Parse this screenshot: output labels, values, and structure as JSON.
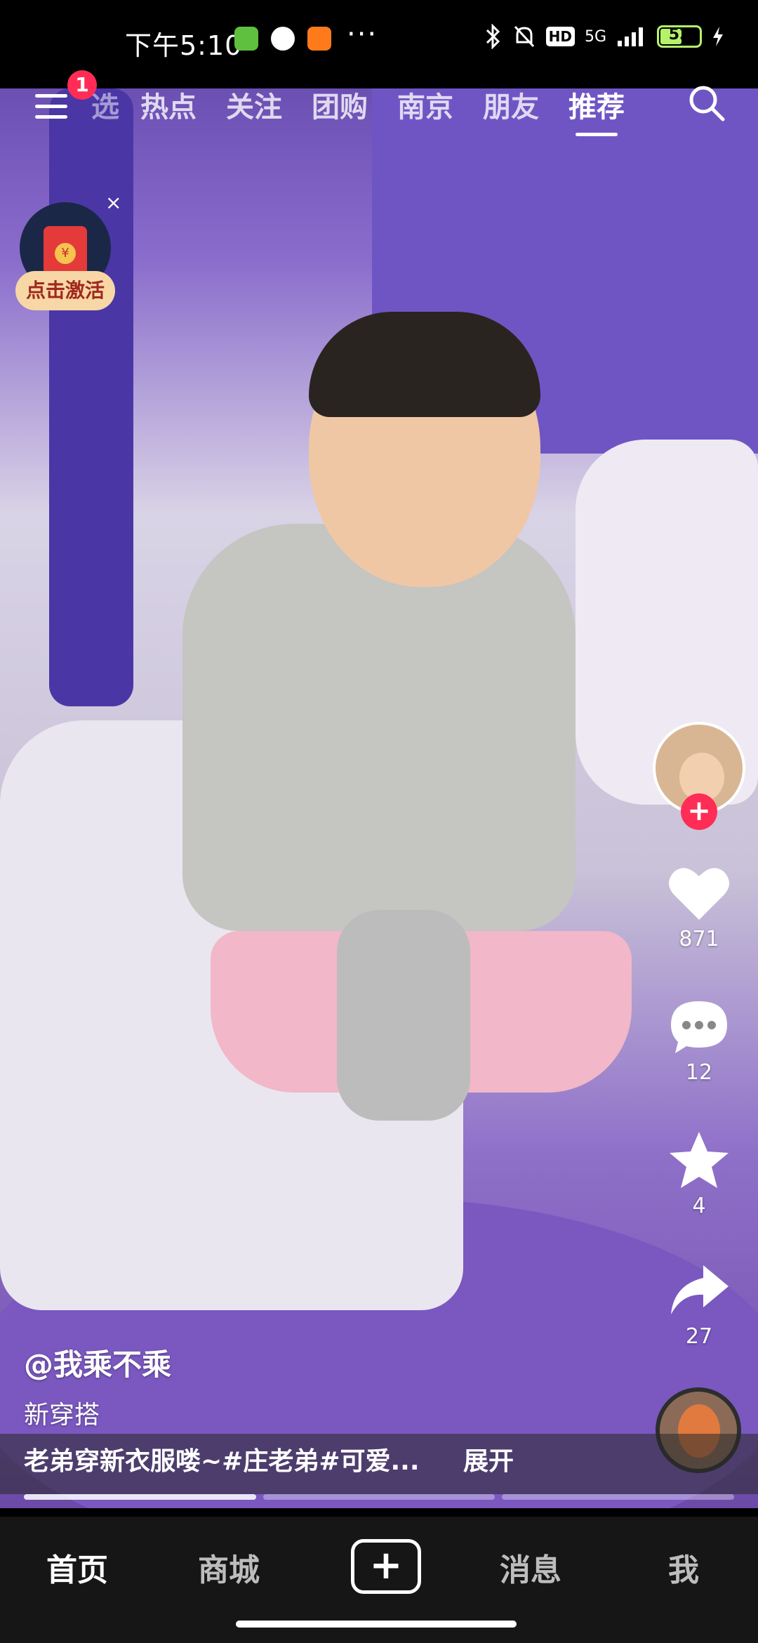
{
  "status_bar": {
    "time": "下午5:10",
    "more": "···",
    "network": "5G",
    "hd": "HD",
    "battery": "52"
  },
  "top_nav": {
    "badge": "1",
    "tabs": [
      {
        "label": "热点"
      },
      {
        "label": "关注"
      },
      {
        "label": "团购"
      },
      {
        "label": "南京"
      },
      {
        "label": "朋友"
      },
      {
        "label": "推荐"
      }
    ],
    "partial_tab": "选"
  },
  "red_packet": {
    "label": "点击激活",
    "close": "×",
    "coin": "¥"
  },
  "actions": {
    "likes": "871",
    "comments": "12",
    "favorites": "4",
    "shares": "27",
    "follow": "+"
  },
  "video_info": {
    "author": "@我乘不乘",
    "tagline": "新穿搭",
    "caption": "老弟穿新衣服喽~#庄老弟#可爱...",
    "expand": "展开"
  },
  "tab_bar": {
    "tabs": [
      {
        "label": "首页"
      },
      {
        "label": "商城"
      },
      {
        "label": "消息"
      },
      {
        "label": "我"
      }
    ],
    "create": "+"
  },
  "colors": {
    "accent": "#ff2d55",
    "battery": "#b5f26a",
    "tab_bar_bg": "#161616"
  }
}
